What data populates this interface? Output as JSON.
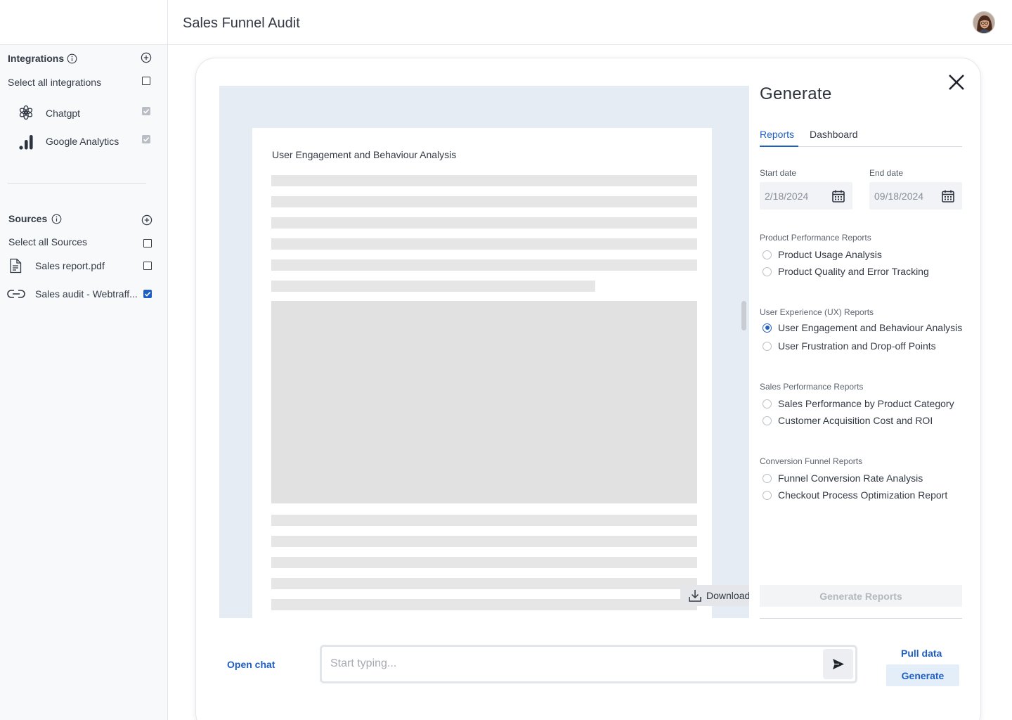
{
  "header": {
    "title": "Sales Funnel Audit"
  },
  "sidebar": {
    "integrations": {
      "title": "Integrations",
      "select_all": "Select all integrations",
      "items": [
        {
          "label": "Chatgpt",
          "icon": "chatgpt-icon",
          "checked": true
        },
        {
          "label": "Google Analytics",
          "icon": "analytics-icon",
          "checked": true
        }
      ]
    },
    "sources": {
      "title": "Sources",
      "select_all": "Select all Sources",
      "items": [
        {
          "label": "Sales report.pdf",
          "icon": "document-icon",
          "checked": false
        },
        {
          "label": "Sales audit - Webtraff...",
          "icon": "link-icon",
          "checked": true
        }
      ]
    }
  },
  "preview": {
    "doc_title": "User Engagement and Behaviour Analysis",
    "download_label": "Download"
  },
  "panel": {
    "title": "Generate",
    "tabs": [
      {
        "label": "Reports",
        "active": true
      },
      {
        "label": "Dashboard",
        "active": false
      }
    ],
    "start_date": {
      "label": "Start date",
      "value": "2/18/2024"
    },
    "end_date": {
      "label": "End date",
      "value": "09/18/2024"
    },
    "groups": [
      {
        "label": "Product Performance Reports",
        "options": [
          "Product Usage Analysis",
          "Product Quality and Error Tracking"
        ]
      },
      {
        "label": "User Experience (UX) Reports",
        "options": [
          "User Engagement and Behaviour Analysis",
          "User Frustration and Drop-off Points"
        ]
      },
      {
        "label": "Sales Performance Reports",
        "options": [
          "Sales Performance by Product Category",
          "Customer Acquisition Cost and ROI"
        ]
      },
      {
        "label": "Conversion Funnel Reports",
        "options": [
          "Funnel Conversion Rate Analysis",
          "Checkout Process Optimization Report"
        ]
      }
    ],
    "selected_option": "User Engagement and Behaviour Analysis",
    "generate_reports_label": "Generate Reports"
  },
  "bottom": {
    "open_chat_label": "Open chat",
    "chat_placeholder": "Start typing...",
    "pull_data_label": "Pull data",
    "generate_label": "Generate"
  },
  "colors": {
    "accent": "#1f5fc4",
    "sidebar_bg": "#f7f9fb",
    "preview_bg": "#e6ecf3"
  }
}
